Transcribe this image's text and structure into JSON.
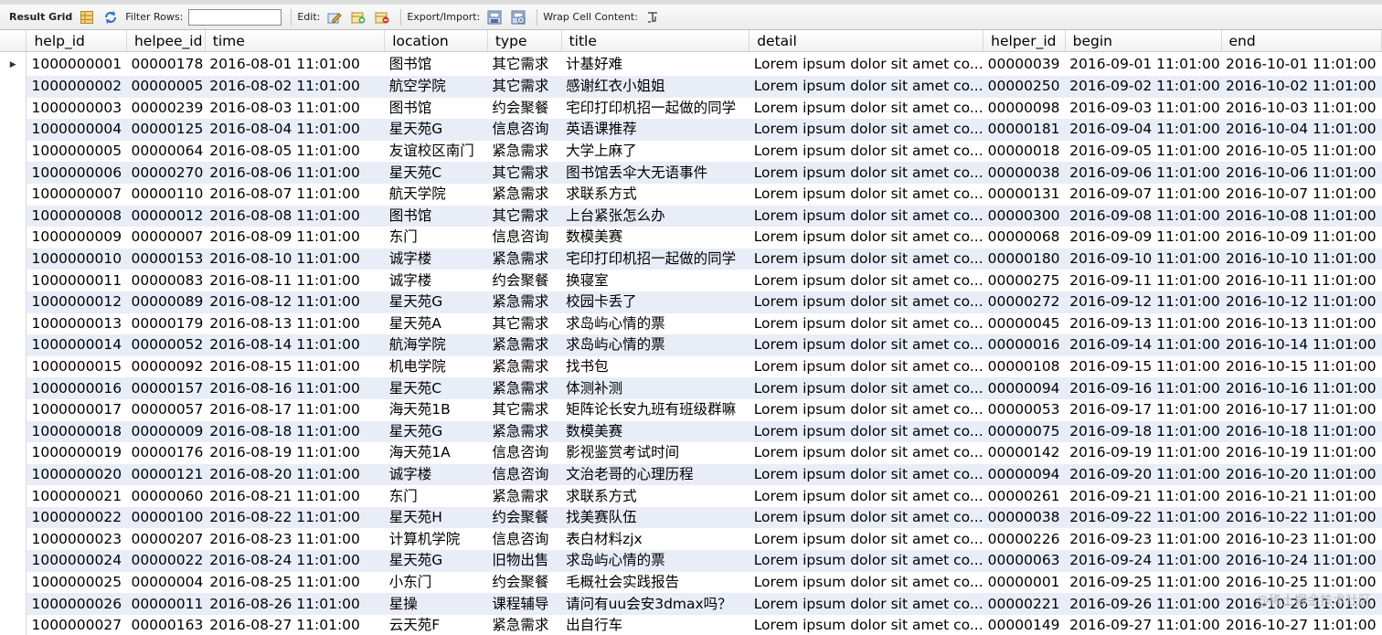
{
  "toolbar": {
    "result_grid_label": "Result Grid",
    "filter_rows_label": "Filter Rows:",
    "filter_value": "",
    "edit_label": "Edit:",
    "export_import_label": "Export/Import:",
    "wrap_cell_label": "Wrap Cell Content:"
  },
  "columns": [
    "help_id",
    "helpee_id",
    "time",
    "location",
    "type",
    "title",
    "detail",
    "helper_id",
    "begin",
    "end"
  ],
  "rows": [
    [
      "1000000001",
      "00000178",
      "2016-08-01 11:01:00",
      "图书馆",
      "其它需求",
      "计基好难",
      "Lorem ipsum dolor sit amet co...",
      "00000039",
      "2016-09-01 11:01:00",
      "2016-10-01 11:01:00"
    ],
    [
      "1000000002",
      "00000005",
      "2016-08-02 11:01:00",
      "航空学院",
      "其它需求",
      "感谢红衣小姐姐",
      "Lorem ipsum dolor sit amet co...",
      "00000250",
      "2016-09-02 11:01:00",
      "2016-10-02 11:01:00"
    ],
    [
      "1000000003",
      "00000239",
      "2016-08-03 11:01:00",
      "图书馆",
      "约会聚餐",
      "宅印打印机招一起做的同学",
      "Lorem ipsum dolor sit amet co...",
      "00000098",
      "2016-09-03 11:01:00",
      "2016-10-03 11:01:00"
    ],
    [
      "1000000004",
      "00000125",
      "2016-08-04 11:01:00",
      "星天苑G",
      "信息咨询",
      "英语课推荐",
      "Lorem ipsum dolor sit amet co...",
      "00000181",
      "2016-09-04 11:01:00",
      "2016-10-04 11:01:00"
    ],
    [
      "1000000005",
      "00000064",
      "2016-08-05 11:01:00",
      "友谊校区南门",
      "紧急需求",
      "大学上麻了",
      "Lorem ipsum dolor sit amet co...",
      "00000018",
      "2016-09-05 11:01:00",
      "2016-10-05 11:01:00"
    ],
    [
      "1000000006",
      "00000270",
      "2016-08-06 11:01:00",
      "星天苑C",
      "其它需求",
      "图书馆丢伞大无语事件",
      "Lorem ipsum dolor sit amet co...",
      "00000038",
      "2016-09-06 11:01:00",
      "2016-10-06 11:01:00"
    ],
    [
      "1000000007",
      "00000110",
      "2016-08-07 11:01:00",
      "航天学院",
      "紧急需求",
      "求联系方式",
      "Lorem ipsum dolor sit amet co...",
      "00000131",
      "2016-09-07 11:01:00",
      "2016-10-07 11:01:00"
    ],
    [
      "1000000008",
      "00000012",
      "2016-08-08 11:01:00",
      "图书馆",
      "其它需求",
      "上台紧张怎么办",
      "Lorem ipsum dolor sit amet co...",
      "00000300",
      "2016-09-08 11:01:00",
      "2016-10-08 11:01:00"
    ],
    [
      "1000000009",
      "00000007",
      "2016-08-09 11:01:00",
      "东门",
      "信息咨询",
      "数模美赛",
      "Lorem ipsum dolor sit amet co...",
      "00000068",
      "2016-09-09 11:01:00",
      "2016-10-09 11:01:00"
    ],
    [
      "1000000010",
      "00000153",
      "2016-08-10 11:01:00",
      "诚字楼",
      "紧急需求",
      "宅印打印机招一起做的同学",
      "Lorem ipsum dolor sit amet co...",
      "00000180",
      "2016-09-10 11:01:00",
      "2016-10-10 11:01:00"
    ],
    [
      "1000000011",
      "00000083",
      "2016-08-11 11:01:00",
      "诚字楼",
      "约会聚餐",
      "换寝室",
      "Lorem ipsum dolor sit amet co...",
      "00000275",
      "2016-09-11 11:01:00",
      "2016-10-11 11:01:00"
    ],
    [
      "1000000012",
      "00000089",
      "2016-08-12 11:01:00",
      "星天苑G",
      "紧急需求",
      "校园卡丢了",
      "Lorem ipsum dolor sit amet co...",
      "00000272",
      "2016-09-12 11:01:00",
      "2016-10-12 11:01:00"
    ],
    [
      "1000000013",
      "00000179",
      "2016-08-13 11:01:00",
      "星天苑A",
      "其它需求",
      "求岛屿心情的票",
      "Lorem ipsum dolor sit amet co...",
      "00000045",
      "2016-09-13 11:01:00",
      "2016-10-13 11:01:00"
    ],
    [
      "1000000014",
      "00000052",
      "2016-08-14 11:01:00",
      "航海学院",
      "紧急需求",
      "求岛屿心情的票",
      "Lorem ipsum dolor sit amet co...",
      "00000016",
      "2016-09-14 11:01:00",
      "2016-10-14 11:01:00"
    ],
    [
      "1000000015",
      "00000092",
      "2016-08-15 11:01:00",
      "机电学院",
      "紧急需求",
      "找书包",
      "Lorem ipsum dolor sit amet co...",
      "00000108",
      "2016-09-15 11:01:00",
      "2016-10-15 11:01:00"
    ],
    [
      "1000000016",
      "00000157",
      "2016-08-16 11:01:00",
      "星天苑C",
      "紧急需求",
      "体测补测",
      "Lorem ipsum dolor sit amet co...",
      "00000094",
      "2016-09-16 11:01:00",
      "2016-10-16 11:01:00"
    ],
    [
      "1000000017",
      "00000057",
      "2016-08-17 11:01:00",
      "海天苑1B",
      "其它需求",
      "矩阵论长安九班有班级群嘛",
      "Lorem ipsum dolor sit amet co...",
      "00000053",
      "2016-09-17 11:01:00",
      "2016-10-17 11:01:00"
    ],
    [
      "1000000018",
      "00000009",
      "2016-08-18 11:01:00",
      "星天苑G",
      "紧急需求",
      "数模美赛",
      "Lorem ipsum dolor sit amet co...",
      "00000075",
      "2016-09-18 11:01:00",
      "2016-10-18 11:01:00"
    ],
    [
      "1000000019",
      "00000176",
      "2016-08-19 11:01:00",
      "海天苑1A",
      "信息咨询",
      "影视鉴赏考试时间",
      "Lorem ipsum dolor sit amet co...",
      "00000142",
      "2016-09-19 11:01:00",
      "2016-10-19 11:01:00"
    ],
    [
      "1000000020",
      "00000121",
      "2016-08-20 11:01:00",
      "诚字楼",
      "信息咨询",
      "文治老哥的心理历程",
      "Lorem ipsum dolor sit amet co...",
      "00000094",
      "2016-09-20 11:01:00",
      "2016-10-20 11:01:00"
    ],
    [
      "1000000021",
      "00000060",
      "2016-08-21 11:01:00",
      "东门",
      "紧急需求",
      "求联系方式",
      "Lorem ipsum dolor sit amet co...",
      "00000261",
      "2016-09-21 11:01:00",
      "2016-10-21 11:01:00"
    ],
    [
      "1000000022",
      "00000100",
      "2016-08-22 11:01:00",
      "星天苑H",
      "约会聚餐",
      "找美赛队伍",
      "Lorem ipsum dolor sit amet co...",
      "00000038",
      "2016-09-22 11:01:00",
      "2016-10-22 11:01:00"
    ],
    [
      "1000000023",
      "00000207",
      "2016-08-23 11:01:00",
      "计算机学院",
      "信息咨询",
      "表白材料zjx",
      "Lorem ipsum dolor sit amet co...",
      "00000226",
      "2016-09-23 11:01:00",
      "2016-10-23 11:01:00"
    ],
    [
      "1000000024",
      "00000022",
      "2016-08-24 11:01:00",
      "星天苑G",
      "旧物出售",
      "求岛屿心情的票",
      "Lorem ipsum dolor sit amet co...",
      "00000063",
      "2016-09-24 11:01:00",
      "2016-10-24 11:01:00"
    ],
    [
      "1000000025",
      "00000004",
      "2016-08-25 11:01:00",
      "小东门",
      "约会聚餐",
      "毛概社会实践报告",
      "Lorem ipsum dolor sit amet co...",
      "00000001",
      "2016-09-25 11:01:00",
      "2016-10-25 11:01:00"
    ],
    [
      "1000000026",
      "00000011",
      "2016-08-26 11:01:00",
      "星操",
      "课程辅导",
      "请问有uu会安3dmax吗？",
      "Lorem ipsum dolor sit amet co...",
      "00000221",
      "2016-09-26 11:01:00",
      "2016-10-26 11:01:00"
    ],
    [
      "1000000027",
      "00000163",
      "2016-08-27 11:01:00",
      "云天苑F",
      "紧急需求",
      "出自行车",
      "Lorem ipsum dolor sit amet co...",
      "00000149",
      "2016-09-27 11:01:00",
      "2016-10-27 11:01:00"
    ]
  ],
  "current_row_index": 0,
  "watermark": "@稀土掘金技术社区"
}
